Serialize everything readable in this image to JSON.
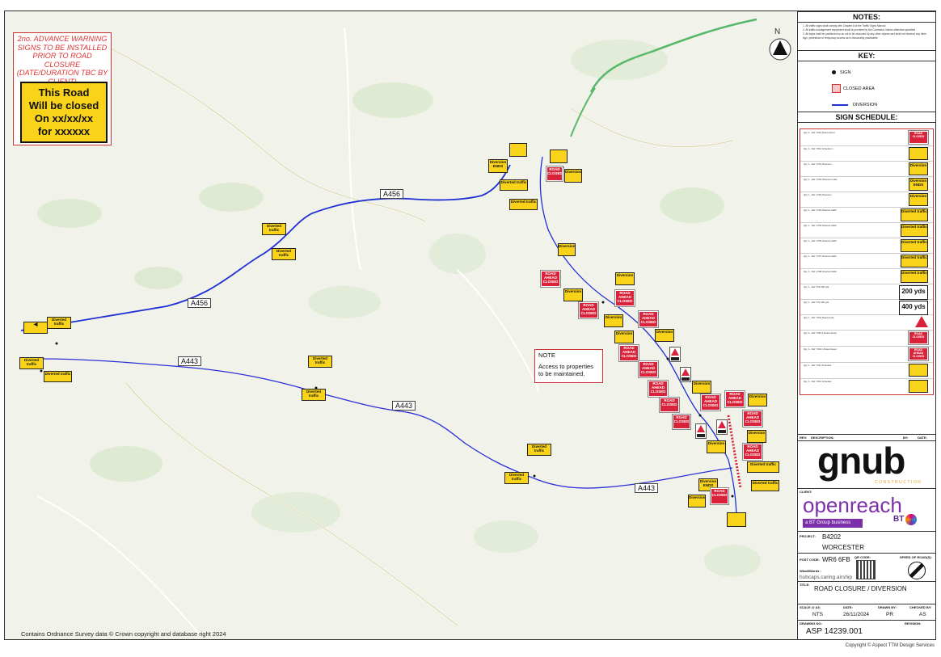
{
  "advance_warning": {
    "text": "2no. ADVANCE WARNING SIGNS TO BE INSTALLED PRIOR TO ROAD CLOSURE (DATE/DURATION TBC BY CLIENT)",
    "sign_line1": "This Road",
    "sign_line2": "Will be closed",
    "sign_line3": "On xx/xx/xx",
    "sign_line4": "for xxxxxx"
  },
  "map": {
    "road_labels": [
      "A456",
      "A456",
      "A443",
      "A443",
      "A443"
    ],
    "north_label": "N",
    "note_title": "NOTE",
    "note_text": "Access to properties to be maintained.",
    "credit": "Contains Ordnance Survey data © Crown copyright and database right 2024",
    "colors": {
      "diversion": "#1f2fd6",
      "a_road": "#3a57e0",
      "sign_yellow": "#f9d31a",
      "sign_red": "#d9233a"
    }
  },
  "signs": {
    "diverted_traffic": "Diverted traffic",
    "diversion": "Diversion",
    "diversion_ends": "Diversion ENDS",
    "road_ahead_closed": "ROAD AHEAD CLOSED",
    "road_closed": "ROAD CLOSED",
    "yds200": "200 yds",
    "yds400": "400 yds"
  },
  "panel": {
    "notes_title": "NOTES:",
    "notes": [
      "1. All traffic signs shall comply with Chapter 8 of the Traffic Signs Manual",
      "2. All traffic management equipment shall be provided by the Contractor unless otherwise specified",
      "3. All signs shall be positioned so as not to be obscured by any other objects and shall not obstruct any other sign, pedestrian or temporary access as is reasonably practicable."
    ],
    "key_title": "KEY:",
    "key_sign": "SIGN",
    "key_closed": "CLOSED AREA",
    "key_diversion": "DIVERSION",
    "schedule_title": "SIGN SCHEDULE:",
    "schedule_rows": [
      "Qty: 2 - Ref: 7019 Road closed",
      "Qty: 1 - Ref: 7011 Schedule 1",
      "Qty: 1 - Ref: 2701 Diversion",
      "Qty: 1 - Ref: 2702 Diversion ends",
      "Qty: 1 - Ref: 2703 Diversion",
      "Qty: 1 - Ref: 2704 Diverted traffic",
      "Qty: 1 - Ref: 2705 Diverted traffic",
      "Qty: 1 - Ref: 2706 Diverted traffic",
      "Qty: 1 - Ref: 2707 Diverted traffic",
      "Qty: 1 - Ref: 2708 Diverted traffic",
      "Qty: 1 - Ref: 572 200 yds",
      "Qty: 1 - Ref: 572 400 yds",
      "Qty: 1 - Ref: 7001 Road works",
      "Qty: 2 - Ref: 7010.1 Road closed",
      "Qty: 1 - Ref: 7010.1 Road closed",
      "Qty: 1 - Ref: 7011 Schedule",
      "Qty: 1 - Ref: 7011 Schedule"
    ],
    "rev_label": "REV:",
    "desc_label": "DESCRIPTION:",
    "by_label": "BY:",
    "date_label": "DATE:",
    "gnub_logo": "gnub",
    "gnub_sub": "CONSTRUCTION",
    "client_label": "CLIENT:",
    "client_logo": "openreach",
    "client_tag": "a BT Group business",
    "bt": "BT",
    "project_label": "PROJECT:",
    "project_ref": "B4202",
    "project_town": "WORCESTER",
    "postcode_label": "POST CODE:",
    "postcode": "WR6 6FB",
    "qr_label": "QR CODE:",
    "speed_label": "SPEED OF ROAD(S):",
    "w3w_label": "What3Words :",
    "w3w": "hubcaps.caring.airship",
    "title_label": "TITLE:",
    "title": "ROAD CLOSURE / DIVERSION",
    "scale_label": "SCALE @ A3:",
    "scale": "NTS",
    "date2_label": "DATE:",
    "date": "26/11/2024",
    "drawn_label": "DRAWN BY:",
    "drawn": "PR",
    "checked_label": "CHECKED BY:",
    "checked": "AS",
    "drawing_label": "DRAWING NO:",
    "drawing": "ASP 14239.001",
    "revision_label": "REVISION:"
  },
  "copyright": "Copyright © Aspect TTM Design Services"
}
